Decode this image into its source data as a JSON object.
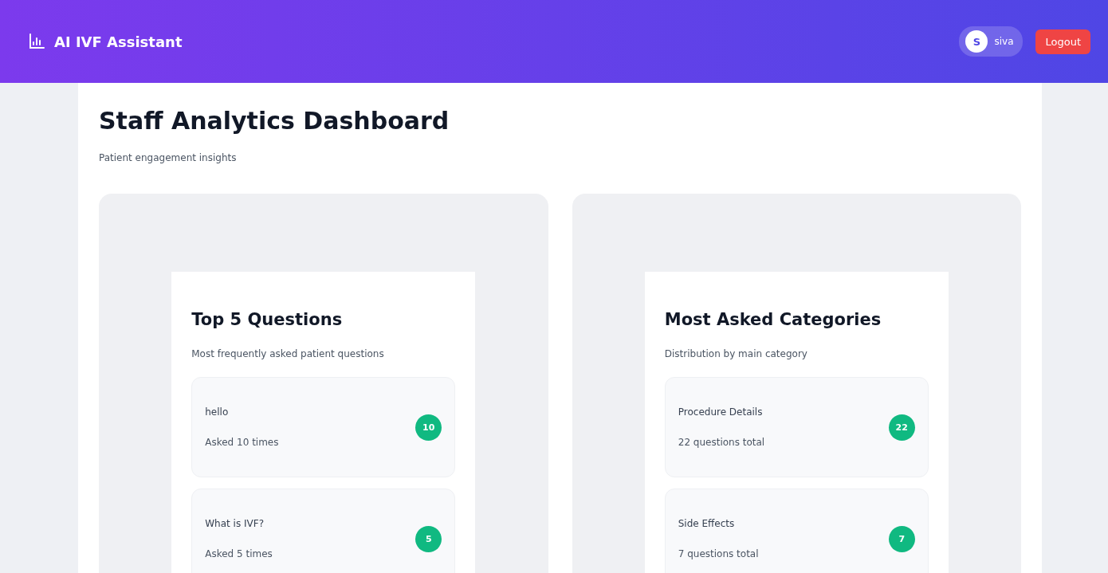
{
  "header": {
    "brand": "AI IVF Assistant",
    "user": {
      "initial": "S",
      "name": "siva"
    },
    "logout": "Logout"
  },
  "page": {
    "title": "Staff Analytics Dashboard",
    "subtitle": "Patient engagement insights"
  },
  "panels": [
    {
      "title": "Top 5 Questions",
      "subtitle": "Most frequently asked patient questions",
      "items": [
        {
          "label": "hello",
          "detail": "Asked 10 times",
          "count": "10"
        },
        {
          "label": "What is IVF?",
          "detail": "Asked 5 times",
          "count": "5"
        }
      ]
    },
    {
      "title": "Most Asked Categories",
      "subtitle": "Distribution by main category",
      "items": [
        {
          "label": "Procedure Details",
          "detail": "22 questions total",
          "count": "22"
        },
        {
          "label": "Side Effects",
          "detail": "7 questions total",
          "count": "7"
        }
      ]
    }
  ]
}
